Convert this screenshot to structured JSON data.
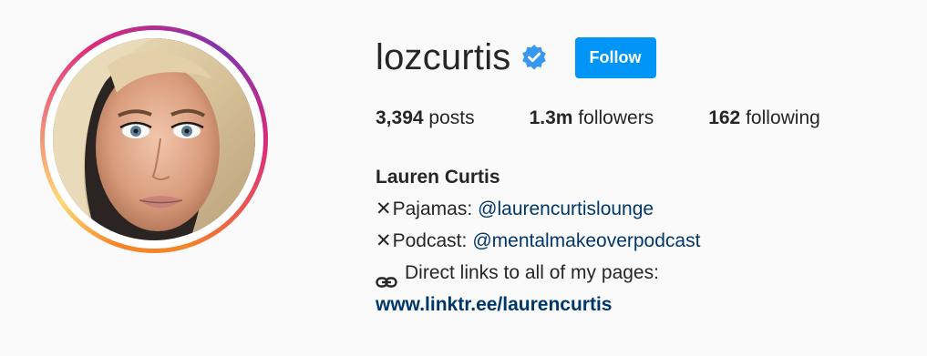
{
  "profile": {
    "username": "lozcurtis",
    "follow_label": "Follow",
    "verified_icon": "verified-badge-icon",
    "stats": {
      "posts_count": "3,394",
      "posts_label": "posts",
      "followers_count": "1.3m",
      "followers_label": "followers",
      "following_count": "162",
      "following_label": "following"
    },
    "bio": {
      "full_name": "Lauren Curtis",
      "line1_mark": "✕",
      "line1_label": "Pajamas:",
      "line1_mention": "@laurencurtislounge",
      "line2_mark": "✕",
      "line2_label": "Podcast:",
      "line2_mention": "@mentalmakeoverpodcast",
      "line3_icon": "link-icon",
      "line3_text": "Direct links to all of my pages:",
      "website": "www.linktr.ee/laurencurtis"
    }
  },
  "colors": {
    "follow_button": "#0095f6",
    "link_text": "#00376b",
    "verified_badge": "#3897f0",
    "background": "#fafafa"
  }
}
